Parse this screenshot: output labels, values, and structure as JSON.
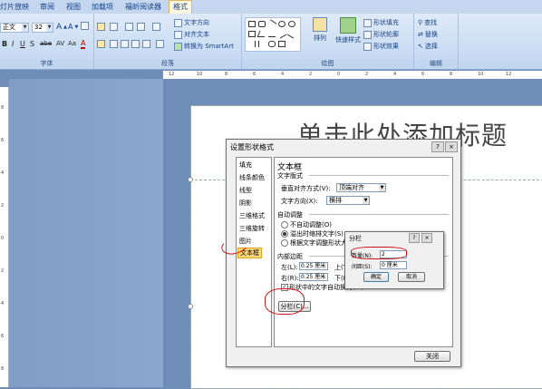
{
  "ribbon": {
    "tabs": [
      "灯片放映",
      "审阅",
      "视图",
      "加载项",
      "福昕阅读器",
      "格式"
    ],
    "font_name": "正文",
    "font_size": "32",
    "groups": [
      "字体",
      "段落",
      "绘图",
      "编辑"
    ],
    "paragraph": {
      "text_direction": "文字方向",
      "align_text": "对齐文本",
      "convert_smartart": "转换为 SmartArt"
    },
    "drawing": {
      "arrange": "排列",
      "quick_styles": "快速样式",
      "shape_fill": "形状填充",
      "shape_outline": "形状轮廓",
      "shape_effects": "形状效果"
    },
    "editing": {
      "find": "查找",
      "replace": "替换",
      "select": "选择"
    }
  },
  "ruler": {
    "h_ticks": [
      "12",
      "10",
      "8",
      "6",
      "4",
      "2",
      "0",
      "2",
      "4",
      "6",
      "8",
      "10",
      "12"
    ],
    "v_ticks": [
      "8",
      "6",
      "4",
      "2",
      "0",
      "2",
      "4",
      "6",
      "8"
    ]
  },
  "slide": {
    "title_placeholder": "单击此处添加标题"
  },
  "dialog": {
    "title": "设置形状格式",
    "help": "?",
    "close": "×",
    "nav": [
      "填充",
      "线条颜色",
      "线型",
      "阴影",
      "三维格式",
      "三维旋转",
      "图片",
      "文本框"
    ],
    "selected_nav": "文本框",
    "panel": {
      "heading": "文本框",
      "layout_section": "文字版式",
      "vertical_align_label": "垂直对齐方式(V):",
      "vertical_align_value": "顶端对齐",
      "text_direction_label": "文字方向(X):",
      "text_direction_value": "横排",
      "autofit_section": "自动调整",
      "autofit_options": [
        "不自动调整(O)",
        "溢出时缩排文字(S)",
        "根据文字调整形状大小(F)"
      ],
      "internal_margin_section": "内部边距",
      "left_label": "左(L):",
      "left_value": "0.25 厘米",
      "right_label": "右(R):",
      "right_value": "0.25 厘米",
      "top_label": "上(T):",
      "bottom_label": "下(B):",
      "wrap_text_label": "形状中的文字自动换行(W)",
      "columns_button": "分栏(C)..."
    },
    "close_button": "关闭"
  },
  "columns_dialog": {
    "title": "分栏",
    "help": "?",
    "close": "×",
    "number_label": "数量(N):",
    "number_value": "2",
    "spacing_label": "间距(S):",
    "spacing_value": "0 厘米",
    "ok": "确定",
    "cancel": "取消"
  },
  "colors": {
    "annotation_red": "#d0111a",
    "selected_item": "#ffd97a",
    "ribbon_blue": "#c9dcf3"
  }
}
